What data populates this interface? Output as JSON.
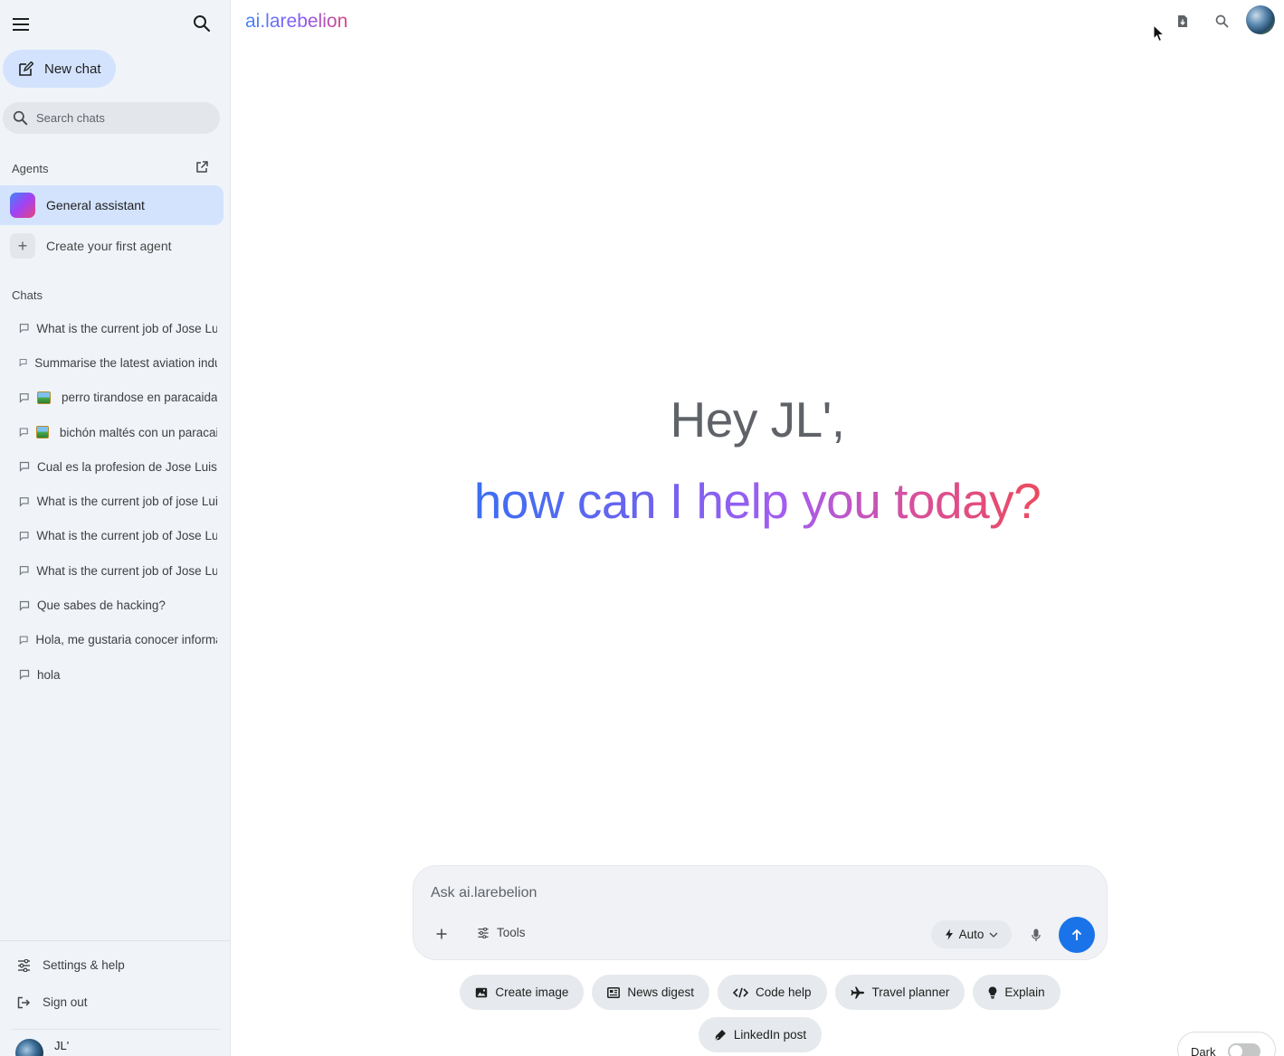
{
  "sidebar": {
    "new_chat_label": "New chat",
    "search_placeholder": "Search chats",
    "agents_label": "Agents",
    "agents": [
      {
        "label": "General assistant"
      },
      {
        "label": "Create your first agent"
      }
    ],
    "chats_label": "Chats",
    "chats": [
      {
        "label": "What is the current job of Jose Luis"
      },
      {
        "label": "Summarise the latest aviation industry news"
      },
      {
        "label": "perro tirandose en paracaidas"
      },
      {
        "label": "bichón maltés con un paracaidas"
      },
      {
        "label": "Cual es la profesion de Jose Luis"
      },
      {
        "label": "What is the current job of jose Luis"
      },
      {
        "label": "What is the current job of Jose Luis"
      },
      {
        "label": "What is the current job of Jose Luis"
      },
      {
        "label": "Que sabes de hacking?"
      },
      {
        "label": "Hola, me gustaria conocer informacion"
      },
      {
        "label": "hola"
      }
    ],
    "settings_label": "Settings & help",
    "signout_label": "Sign out",
    "user_name": "JL'"
  },
  "header": {
    "brand": "ai.larebelion"
  },
  "greeting": {
    "line1": "Hey JL',",
    "line2": "how can I help you today?"
  },
  "composer": {
    "placeholder": "Ask ai.larebelion",
    "tools_label": "Tools",
    "mode_label": "Auto"
  },
  "chips": [
    {
      "label": "Create image",
      "icon": "image-icon"
    },
    {
      "label": "News digest",
      "icon": "newspaper-icon"
    },
    {
      "label": "Code help",
      "icon": "code-icon"
    },
    {
      "label": "Travel planner",
      "icon": "plane-icon"
    },
    {
      "label": "Explain",
      "icon": "lightbulb-icon"
    },
    {
      "label": "LinkedIn post",
      "icon": "pen-icon"
    }
  ],
  "theme_toggle_label": "Dark",
  "colors": {
    "accent": "#1a73e8",
    "sidebar_bg": "#f0f4f9",
    "active_item": "#d3e3fd"
  }
}
